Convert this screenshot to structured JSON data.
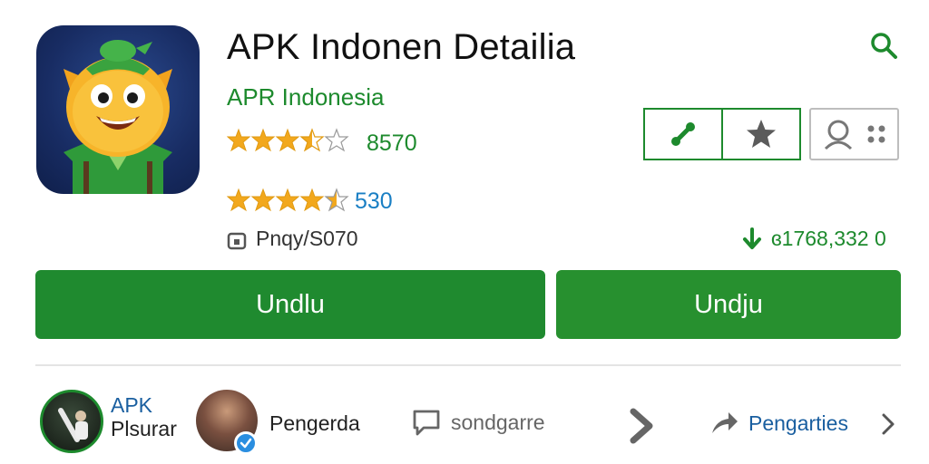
{
  "app": {
    "title": "APK Indonen Detailia",
    "developer": "APR Indonesia",
    "rating_primary": {
      "stars": 3.5,
      "count": "8570"
    },
    "rating_secondary": {
      "stars": 4.5,
      "count": "530"
    },
    "privacy_text": "Pnqy/S070",
    "downloads_text": "ɞ1768,332 0"
  },
  "icons": {
    "search": "search-icon",
    "share_link": "link-icon",
    "favorite": "star-icon",
    "people": "people-icon",
    "lock": "lock-icon",
    "download": "download-arrow-icon",
    "comment": "comment-icon",
    "chevron": "chevron-right-icon",
    "share": "share-arrow-icon",
    "verified": "verified-badge-icon"
  },
  "actions": {
    "primary_label": "Undlu",
    "secondary_label": "Undju"
  },
  "bottom": {
    "apk_line1": "APK",
    "apk_line2": "Plsurar",
    "profile_name": "Pengerda",
    "comment_label": "sondgarre",
    "share_label": "Pengarties"
  },
  "colors": {
    "brand_green": "#1f8a2f",
    "link_blue": "#1a5fa0",
    "star_gold": "#f2a81d"
  }
}
